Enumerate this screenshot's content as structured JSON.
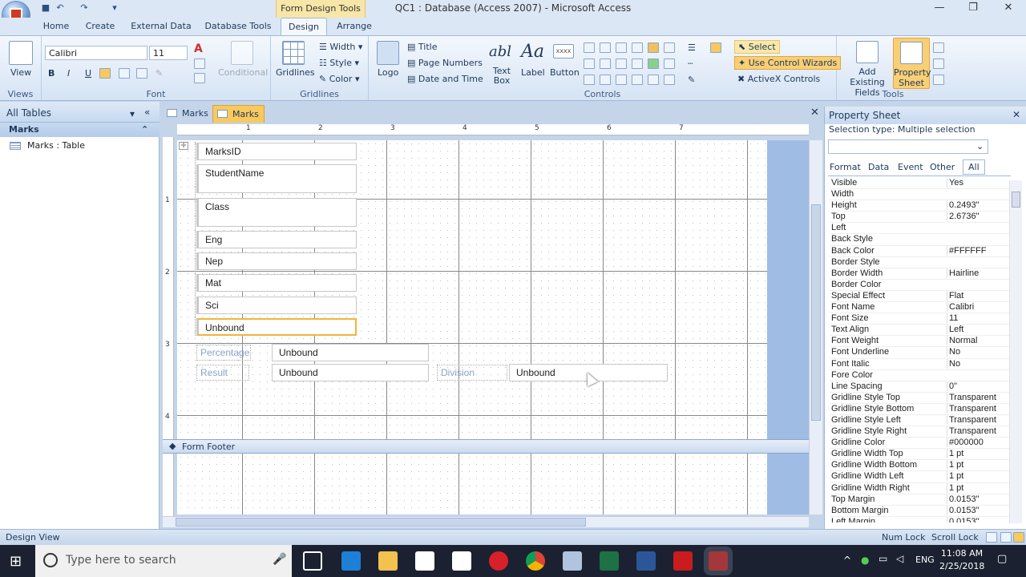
{
  "window": {
    "title": "QC1 : Database (Access 2007) - Microsoft Access",
    "context_tab": "Form Design Tools"
  },
  "tabs": [
    "Home",
    "Create",
    "External Data",
    "Database Tools",
    "Design",
    "Arrange"
  ],
  "ribbon": {
    "views": {
      "view_label": "View",
      "group": "Views"
    },
    "font": {
      "font_name": "Calibri",
      "font_size": "11",
      "conditional": "Conditional",
      "group": "Font",
      "bold": "B",
      "italic": "I",
      "underline": "U"
    },
    "gridlines": {
      "gridlines_label": "Gridlines",
      "width": "Width",
      "style": "Style",
      "color": "Color",
      "group": "Gridlines"
    },
    "controls": {
      "logo": "Logo",
      "title": "Title",
      "page_numbers": "Page Numbers",
      "date_time": "Date and Time",
      "text_box": "Text Box",
      "label": "Label",
      "button": "Button",
      "select": "Select",
      "use_wizards": "Use Control Wizards",
      "activex": "ActiveX Controls",
      "group": "Controls"
    },
    "tools": {
      "add_fields": "Add Existing Fields",
      "property_sheet": "Property Sheet",
      "group": "Tools"
    }
  },
  "nav": {
    "header": "All Tables",
    "group": "Marks",
    "item": "Marks : Table"
  },
  "doc_tabs": [
    "Marks",
    "Marks"
  ],
  "form": {
    "fields": [
      "MarksID",
      "StudentName",
      "Class",
      "Eng",
      "Nep",
      "Mat",
      "Sci",
      "Unbound"
    ],
    "percentage_label": "Percentage",
    "percentage_value": "Unbound",
    "result_label": "Result",
    "result_value": "Unbound",
    "division_label": "Division",
    "division_value": "Unbound",
    "footer": "Form Footer"
  },
  "property_sheet": {
    "title": "Property Sheet",
    "selection_type": "Selection type:  Multiple selection",
    "tabs": [
      "Format",
      "Data",
      "Event",
      "Other",
      "All"
    ],
    "rows": [
      {
        "k": "Visible",
        "v": "Yes"
      },
      {
        "k": "Width",
        "v": ""
      },
      {
        "k": "Height",
        "v": "0.2493\""
      },
      {
        "k": "Top",
        "v": "2.6736\""
      },
      {
        "k": "Left",
        "v": ""
      },
      {
        "k": "Back Style",
        "v": ""
      },
      {
        "k": "Back Color",
        "v": "#FFFFFF"
      },
      {
        "k": "Border Style",
        "v": ""
      },
      {
        "k": "Border Width",
        "v": "Hairline"
      },
      {
        "k": "Border Color",
        "v": ""
      },
      {
        "k": "Special Effect",
        "v": "Flat"
      },
      {
        "k": "Font Name",
        "v": "Calibri"
      },
      {
        "k": "Font Size",
        "v": "11"
      },
      {
        "k": "Text Align",
        "v": "Left"
      },
      {
        "k": "Font Weight",
        "v": "Normal"
      },
      {
        "k": "Font Underline",
        "v": "No"
      },
      {
        "k": "Font Italic",
        "v": "No"
      },
      {
        "k": "Fore Color",
        "v": ""
      },
      {
        "k": "Line Spacing",
        "v": "0\""
      },
      {
        "k": "Gridline Style Top",
        "v": "Transparent"
      },
      {
        "k": "Gridline Style Bottom",
        "v": "Transparent"
      },
      {
        "k": "Gridline Style Left",
        "v": "Transparent"
      },
      {
        "k": "Gridline Style Right",
        "v": "Transparent"
      },
      {
        "k": "Gridline Color",
        "v": "#000000"
      },
      {
        "k": "Gridline Width Top",
        "v": "1 pt"
      },
      {
        "k": "Gridline Width Bottom",
        "v": "1 pt"
      },
      {
        "k": "Gridline Width Left",
        "v": "1 pt"
      },
      {
        "k": "Gridline Width Right",
        "v": "1 pt"
      },
      {
        "k": "Top Margin",
        "v": "0.0153\""
      },
      {
        "k": "Bottom Margin",
        "v": "0.0153\""
      },
      {
        "k": "Left Margin",
        "v": "0.0153\""
      }
    ]
  },
  "status": {
    "left": "Design View",
    "num_lock": "Num Lock",
    "scroll_lock": "Scroll Lock"
  },
  "taskbar": {
    "search_placeholder": "Type here to search",
    "time": "11:08 AM",
    "date": "2/25/2018",
    "lang": "ENG"
  },
  "ruler_numbers": [
    "1",
    "2",
    "3",
    "4",
    "5",
    "6",
    "7"
  ],
  "vruler_numbers": [
    "1",
    "2",
    "3",
    "4"
  ]
}
